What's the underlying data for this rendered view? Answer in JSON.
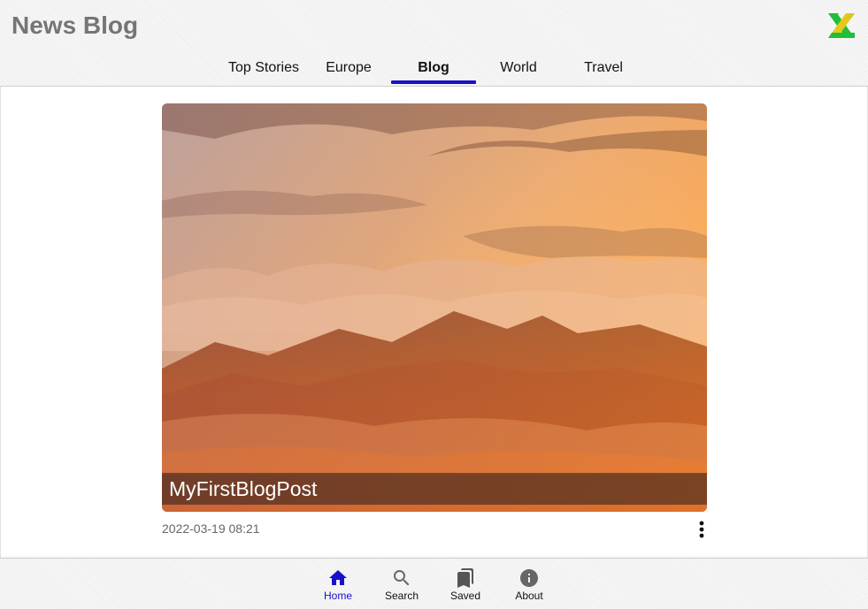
{
  "header": {
    "title": "News Blog",
    "logo_icon": "app-logo-x-icon"
  },
  "tabs": [
    {
      "label": "Top Stories",
      "active": false
    },
    {
      "label": "Europe",
      "active": false
    },
    {
      "label": "Blog",
      "active": true
    },
    {
      "label": "World",
      "active": false
    },
    {
      "label": "Travel",
      "active": false
    }
  ],
  "post": {
    "title": "MyFirstBlogPost",
    "date": "2022-03-19 08:21",
    "image_icon": "mountain-sunset-photo",
    "menu_icon": "more-vertical-icon"
  },
  "bottom_nav": [
    {
      "label": "Home",
      "icon": "home-icon",
      "active": true
    },
    {
      "label": "Search",
      "icon": "search-icon",
      "active": false
    },
    {
      "label": "Saved",
      "icon": "bookmarks-icon",
      "active": false
    },
    {
      "label": "About",
      "icon": "info-icon",
      "active": false
    }
  ],
  "colors": {
    "accent": "#1a10c9",
    "title_gray": "#757575"
  }
}
